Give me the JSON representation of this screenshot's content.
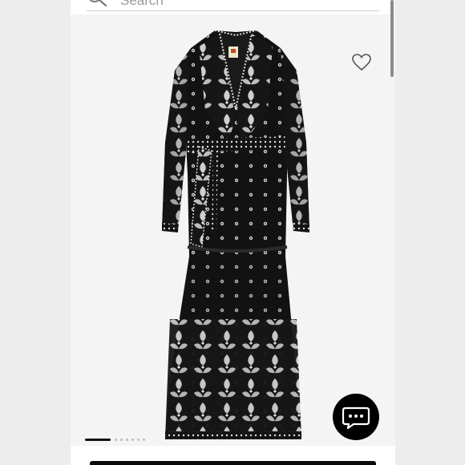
{
  "search": {
    "placeholder": "Search",
    "icon": "search-icon"
  },
  "product": {
    "image_description_icon": "dress-photo",
    "wishlist_icon": "heart-outline-icon"
  },
  "carousel": {
    "total_slides": 7,
    "active_index": 0
  },
  "chat": {
    "icon": "chat-bubble-icon"
  },
  "colors": {
    "accent": "#000000",
    "background": "#ffffff",
    "image_bg": "#f4f4f4"
  }
}
